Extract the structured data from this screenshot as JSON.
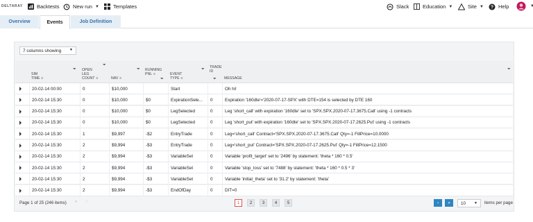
{
  "brand": "DELTARAY",
  "nav": {
    "backtests": "Backtests",
    "new_run": "New run",
    "templates": "Templates",
    "slack": "Slack",
    "education": "Education",
    "site": "Site",
    "help": "Help"
  },
  "tabs": [
    "Overview",
    "Events",
    "Job Definition"
  ],
  "columns_select": "7 columns showing",
  "headers": {
    "sim_time": [
      "SIM",
      "TIME"
    ],
    "open_leg": [
      "OPEN",
      "LEG",
      "COUNT"
    ],
    "nav": [
      "NAV"
    ],
    "running_pnl": [
      "RUNNING",
      "PNL"
    ],
    "event_type": [
      "EVENT",
      "TYPE"
    ],
    "trade_id": [
      "TRADE",
      "ID"
    ],
    "message": [
      "MESSAGE"
    ]
  },
  "rows": [
    {
      "sim_time": "20-02-14 00:00",
      "open_leg": "0",
      "nav": "$10,000",
      "pnl": "",
      "event": "Start",
      "trade": "",
      "message": "Oh hi!"
    },
    {
      "sim_time": "20-02-14 15:30",
      "open_leg": "0",
      "nav": "$10,000",
      "pnl": "$0",
      "event": "ExpirationSele...",
      "trade": "0",
      "message": "Expiration '160dte'='2020-07-17-SPX' with DTE=154 is selected by DTE 160"
    },
    {
      "sim_time": "20-02-14 15:30",
      "open_leg": "0",
      "nav": "$10,000",
      "pnl": "$0",
      "event": "LegSelected",
      "trade": "0",
      "message": "Leg 'short_call' with expiration '160dte' set to 'SPX.SPX.2020-07-17.3675.Call' using -1 contracts"
    },
    {
      "sim_time": "20-02-14 15:30",
      "open_leg": "0",
      "nav": "$10,000",
      "pnl": "$0",
      "event": "LegSelected",
      "trade": "0",
      "message": "Leg 'short_put' with expiration '160dte' set to 'SPX.SPX.2020-07-17.2625.Put' using -1 contracts"
    },
    {
      "sim_time": "20-02-14 15:30",
      "open_leg": "1",
      "nav": "$9,997",
      "pnl": "-$2",
      "event": "EntryTrade",
      "trade": "0",
      "message": "Leg='short_call' Contract='SPX.SPX.2020-07-17.3675.Call' Qty=-1 FillPrice=10.0000"
    },
    {
      "sim_time": "20-02-14 15:30",
      "open_leg": "2",
      "nav": "$9,994",
      "pnl": "-$3",
      "event": "EntryTrade",
      "trade": "0",
      "message": "Leg='short_put' Contract='SPX.SPX.2020-07-17.2625.Put' Qty=-1 FillPrice=12.1500"
    },
    {
      "sim_time": "20-02-14 15:30",
      "open_leg": "2",
      "nav": "$9,994",
      "pnl": "-$3",
      "event": "VariableSet",
      "trade": "0",
      "message": "Variable 'profit_target' set to '2496' by statement: 'theta * 160 * 0.5'"
    },
    {
      "sim_time": "20-02-14 15:30",
      "open_leg": "2",
      "nav": "$9,994",
      "pnl": "-$3",
      "event": "VariableSet",
      "trade": "0",
      "message": "Variable 'stop_loss' set to '7488' by statement: 'theta * 160 * 0.5 * 3'"
    },
    {
      "sim_time": "20-02-14 15:30",
      "open_leg": "2",
      "nav": "$9,994",
      "pnl": "-$3",
      "event": "VariableSet",
      "trade": "0",
      "message": "Variable 'initial_theta' set to '31.2' by statement: 'theta'"
    },
    {
      "sim_time": "20-02-14 15:30",
      "open_leg": "2",
      "nav": "$9,994",
      "pnl": "-$3",
      "event": "EndOfDay",
      "trade": "0",
      "message": "DIT=0"
    }
  ],
  "pager": {
    "info": "Page 1 of 25 (246 items)",
    "pages": [
      "1",
      "2",
      "3",
      "4",
      "5"
    ],
    "page_size": "10",
    "page_size_label": "items per page"
  }
}
